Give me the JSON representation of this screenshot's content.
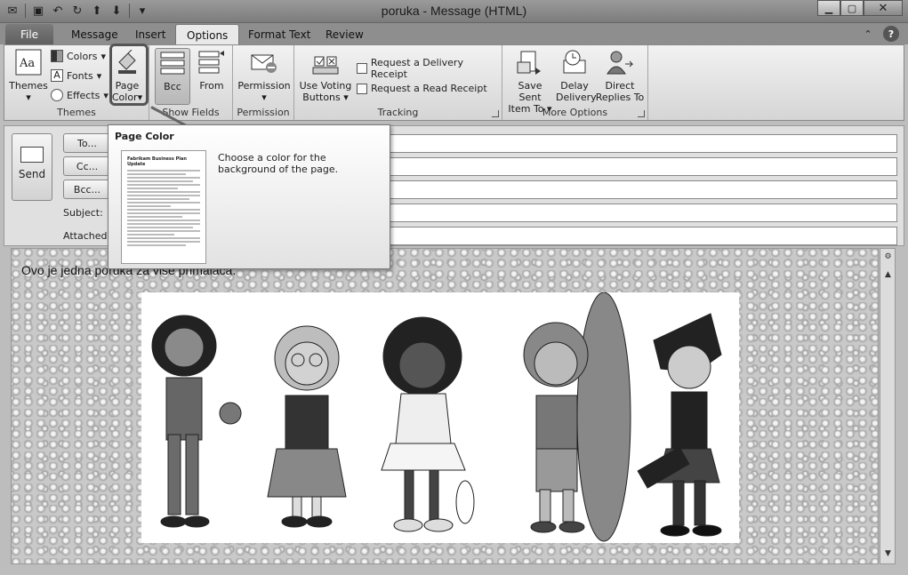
{
  "window": {
    "title": "poruka  -  Message (HTML)",
    "buttons": [
      "minimize",
      "maximize",
      "close"
    ]
  },
  "qat": [
    "outlook-icon",
    "save-icon",
    "undo-icon",
    "redo-icon",
    "up-arrow-icon",
    "down-arrow-icon",
    "customize-icon"
  ],
  "tabs": [
    {
      "label": "File"
    },
    {
      "label": "Message"
    },
    {
      "label": "Insert"
    },
    {
      "label": "Options"
    },
    {
      "label": "Format Text"
    },
    {
      "label": "Review"
    }
  ],
  "ribbon": {
    "themes": {
      "group_label": "Themes",
      "themes_label": "Themes",
      "colors_label": "Colors",
      "fonts_label": "Fonts",
      "effects_label": "Effects",
      "page_color_label1": "Page",
      "page_color_label2": "Color"
    },
    "show_fields": {
      "group_label": "Show Fields",
      "bcc_label": "Bcc",
      "from_label": "From"
    },
    "permission": {
      "group_label": "Permission",
      "permission_label": "Permission"
    },
    "tracking": {
      "group_label": "Tracking",
      "voting_label1": "Use Voting",
      "voting_label2": "Buttons",
      "delivery_receipt": "Request a Delivery Receipt",
      "read_receipt": "Request a Read Receipt"
    },
    "more_options": {
      "group_label": "More Options",
      "save_sent_label1": "Save Sent",
      "save_sent_label2": "Item To",
      "delay_label1": "Delay",
      "delay_label2": "Delivery",
      "direct_label1": "Direct",
      "direct_label2": "Replies To"
    }
  },
  "form": {
    "send_label": "Send",
    "to_label": "To...",
    "cc_label": "Cc...",
    "bcc_label": "Bcc...",
    "subject_label": "Subject:",
    "attached_label": "Attached:"
  },
  "tooltip": {
    "title": "Page Color",
    "description": "Choose a color for the background of the page.",
    "thumb_title": "Fabrikam Business Plan Update"
  },
  "body": {
    "text": "Ovo je jedna poruka za više primalaca."
  }
}
